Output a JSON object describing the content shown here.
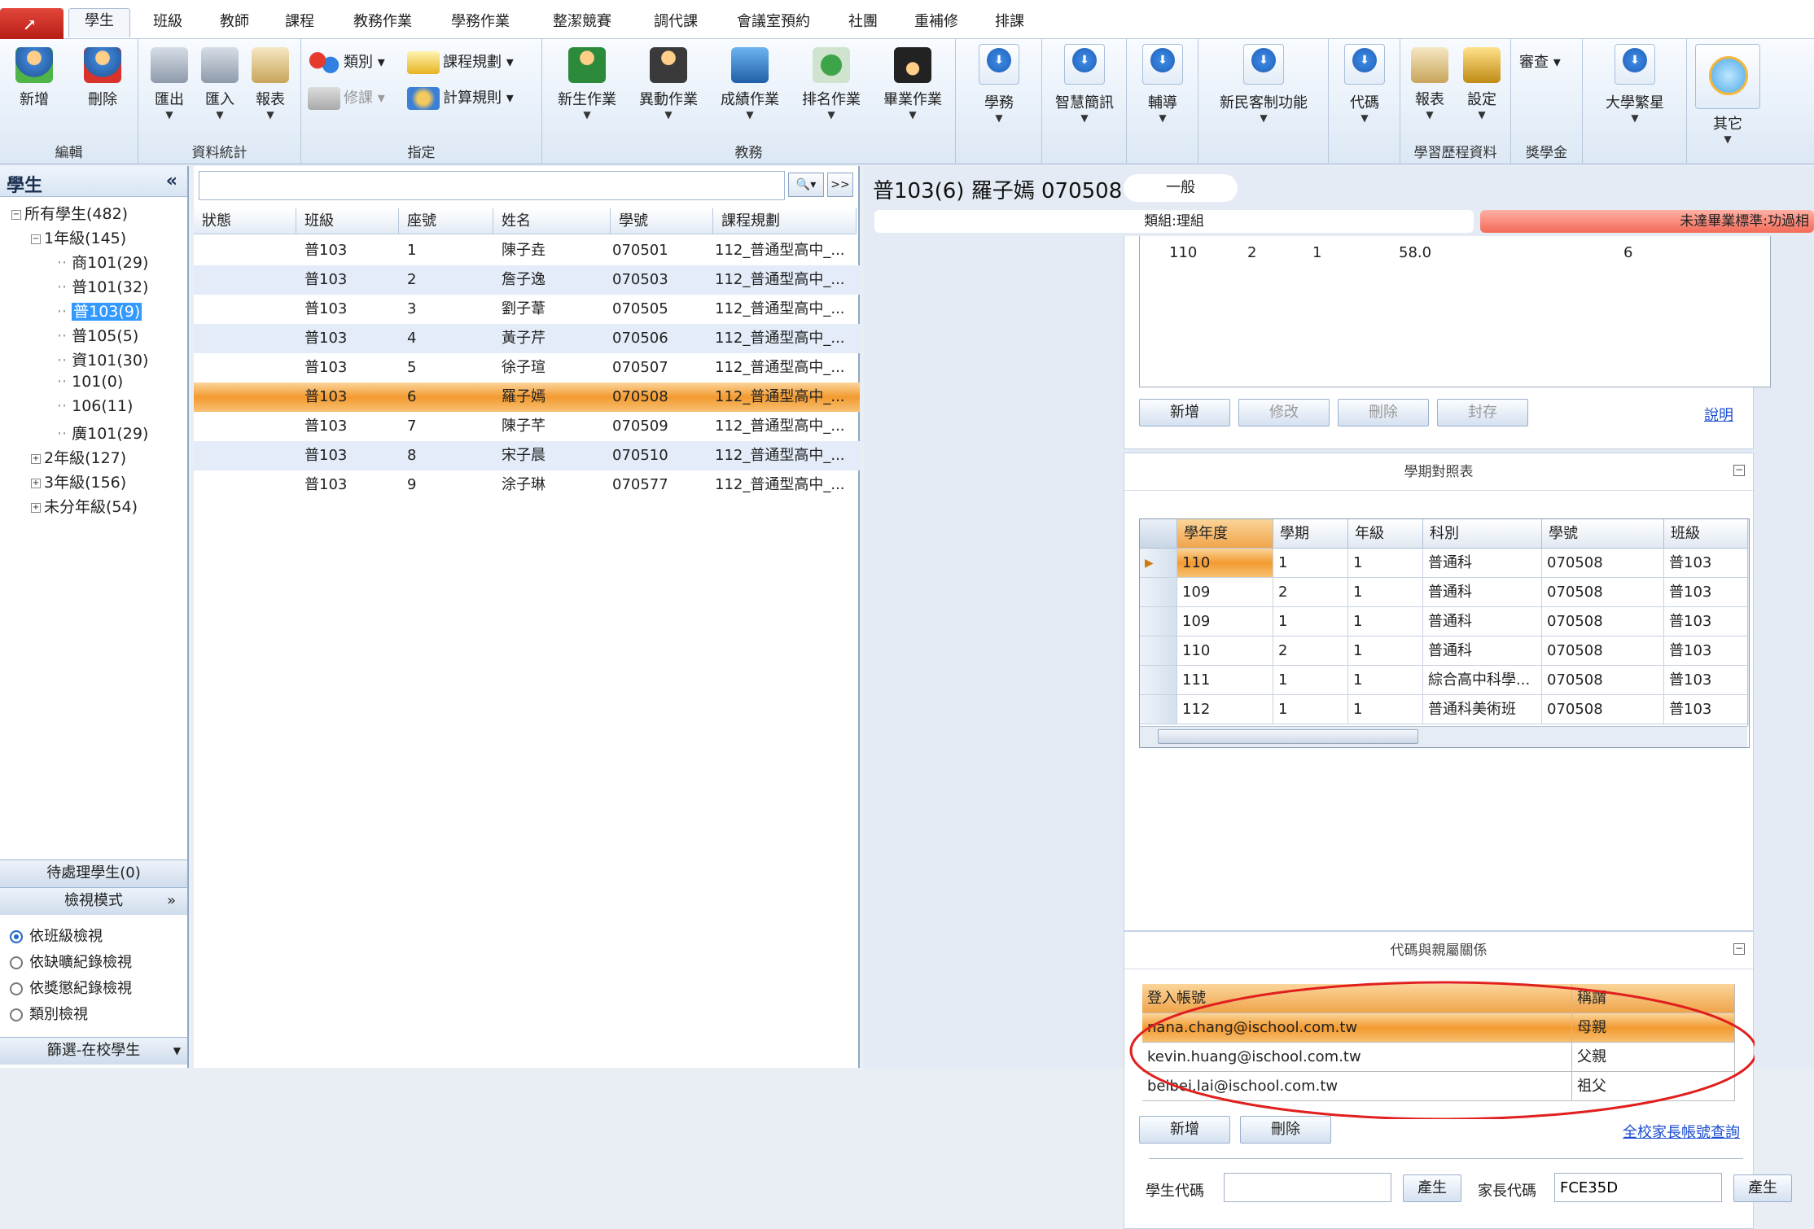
{
  "tabs": [
    "學生",
    "班級",
    "教師",
    "課程",
    "教務作業",
    "學務作業",
    "整潔競賽",
    "調代課",
    "會議室預約",
    "社團",
    "重補修",
    "排課"
  ],
  "ribbon": {
    "add": "新增",
    "delete": "刪除",
    "group_edit": "編輯",
    "export": "匯出",
    "import": "匯入",
    "report": "報表",
    "group_stats": "資料統計",
    "category": "類別",
    "course_plan": "課程規劃",
    "repair": "修課",
    "calc_rule": "計算規則",
    "group_assign": "指定",
    "newstudent": "新生作業",
    "change": "異動作業",
    "score": "成績作業",
    "rank": "排名作業",
    "graduate": "畢業作業",
    "group_academic": "教務",
    "student_affairs": "學務",
    "smart_msg": "智慧簡訊",
    "counsel": "輔導",
    "newresident": "新民客制功能",
    "code": "代碼",
    "report2": "報表",
    "setting": "設定",
    "group_portfolio": "學習歷程資料",
    "review": "審查",
    "group_scholarship": "獎學金",
    "university": "大學繁星",
    "others": "其它"
  },
  "left": {
    "title": "學生",
    "collapse": "«",
    "tree": [
      {
        "label": "所有學生(482)",
        "exp": "⊟"
      },
      {
        "label": "1年級(145)",
        "exp": "⊟"
      },
      {
        "label": "商101(29)"
      },
      {
        "label": "普101(32)"
      },
      {
        "label": "普103(9)",
        "selected": true
      },
      {
        "label": "普105(5)"
      },
      {
        "label": "資101(30)"
      },
      {
        "label": "101(0)"
      },
      {
        "label": "106(11)"
      },
      {
        "label": "廣101(29)"
      },
      {
        "label": "2年級(127)",
        "exp": "⊞"
      },
      {
        "label": "3年級(156)",
        "exp": "⊞"
      },
      {
        "label": "未分年級(54)",
        "exp": "⊞"
      }
    ],
    "pending": "待處理學生(0)",
    "view_mode": "檢視模式",
    "view_mode_chevron": "»",
    "radios": [
      "依班級檢視",
      "依缺曠紀錄檢視",
      "依獎懲紀錄檢視",
      "類別檢視"
    ],
    "filter": "篩選-在校學生"
  },
  "mid": {
    "search_btn": "🔍▾",
    "more_btn": ">>",
    "headers": [
      "狀態",
      "班級",
      "座號",
      "姓名",
      "學號",
      "課程規劃"
    ],
    "rows": [
      [
        "",
        "普103",
        "1",
        "陳子垚",
        "070501",
        "112_普通型高中_..."
      ],
      [
        "",
        "普103",
        "2",
        "詹子逸",
        "070503",
        "112_普通型高中_..."
      ],
      [
        "",
        "普103",
        "3",
        "劉子葦",
        "070505",
        "112_普通型高中_..."
      ],
      [
        "",
        "普103",
        "4",
        "黃子芹",
        "070506",
        "112_普通型高中_..."
      ],
      [
        "",
        "普103",
        "5",
        "徐子瑄",
        "070507",
        "112_普通型高中_..."
      ],
      [
        "",
        "普103",
        "6",
        "羅子嫣",
        "070508",
        "112_普通型高中_..."
      ],
      [
        "",
        "普103",
        "7",
        "陳子芊",
        "070509",
        "112_普通型高中_..."
      ],
      [
        "",
        "普103",
        "8",
        "宋子晨",
        "070510",
        "112_普通型高中_..."
      ],
      [
        "",
        "普103",
        "9",
        "涂子琳",
        "070577",
        "112_普通型高中_..."
      ]
    ],
    "selected_row": 5
  },
  "right": {
    "title": "普103(6) 羅子嫣 070508",
    "pill": "一般",
    "info1": "類組:理組",
    "info2": "未達畢業標準:功過相",
    "top_row": [
      "110",
      "2",
      "1",
      "58.0",
      "6"
    ],
    "top_buttons": [
      "新增",
      "修改",
      "刪除",
      "封存"
    ],
    "help": "說明",
    "semester_title": "學期對照表",
    "semester_headers": [
      "學年度",
      "學期",
      "年級",
      "科別",
      "學號",
      "班級"
    ],
    "semester_rows": [
      [
        "110",
        "1",
        "1",
        "普通科",
        "070508",
        "普103"
      ],
      [
        "109",
        "2",
        "1",
        "普通科",
        "070508",
        "普103"
      ],
      [
        "109",
        "1",
        "1",
        "普通科",
        "070508",
        "普103"
      ],
      [
        "110",
        "2",
        "1",
        "普通科",
        "070508",
        "普103"
      ],
      [
        "111",
        "1",
        "1",
        "綜合高中科學...",
        "070508",
        "普103"
      ],
      [
        "112",
        "1",
        "1",
        "普通科美術班",
        "070508",
        "普103"
      ]
    ],
    "parent_title": "代碼與親屬關係",
    "parent_headers": [
      "登入帳號",
      "稱謂"
    ],
    "parents": [
      [
        "nana.chang@ischool.com.tw",
        "母親"
      ],
      [
        "kevin.huang@ischool.com.tw",
        "父親"
      ],
      [
        "beibei.lai@ischool.com.tw",
        "祖父"
      ]
    ],
    "parent_buttons": [
      "新增",
      "刪除"
    ],
    "parent_link": "全校家長帳號查詢",
    "student_code_label": "學生代碼",
    "student_code": "",
    "generate": "產生",
    "parent_code_label": "家長代碼",
    "parent_code": "FCE35D"
  }
}
